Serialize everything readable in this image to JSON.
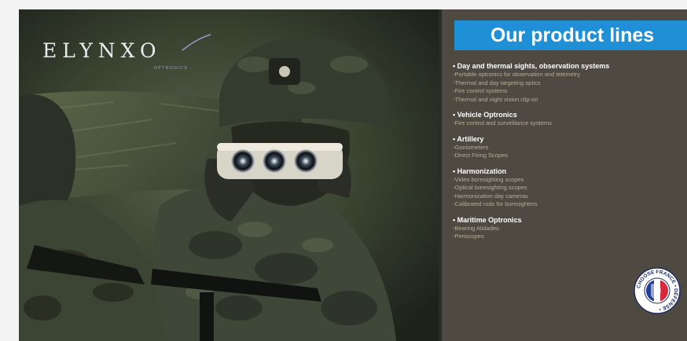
{
  "brand": {
    "name": "ELYNXO",
    "tagline": "OPTRONICS"
  },
  "panel": {
    "title": "Our product lines",
    "bullet": "•",
    "dash": "-",
    "categories": [
      {
        "name": "Day and thermal sights, observation systems",
        "items": [
          "Portable optronics for observation and telemetry",
          "Thermal and day targeting optics",
          "Fire control systems",
          "Thermal and night vision clip-on"
        ]
      },
      {
        "name": "Vehicle Optronics",
        "items": [
          "Fire control and surveillance systems"
        ]
      },
      {
        "name": "Artillery",
        "items": [
          "Goniometers",
          "Direct Firing Scopes"
        ]
      },
      {
        "name": "Harmonization",
        "items": [
          "Video boresighting scopes",
          "Optical boresighting scopes",
          "Harmonization day cameras",
          "Calibrated rods for boresighters"
        ]
      },
      {
        "name": "Maritime Optronics",
        "items": [
          "Bearing Alidades",
          "Periscopes"
        ]
      }
    ]
  },
  "badge": {
    "text": "CHOOSE FRANCE • DÉFENSE •"
  },
  "colors": {
    "title_bg": "#1f8fd6",
    "panel_bg": "#4e4a42",
    "item_text": "#b9ab97",
    "head_text": "#ffffff"
  },
  "icons": {
    "badge": "france-flag-badge-icon",
    "logo": "elynxo-logo-icon"
  }
}
